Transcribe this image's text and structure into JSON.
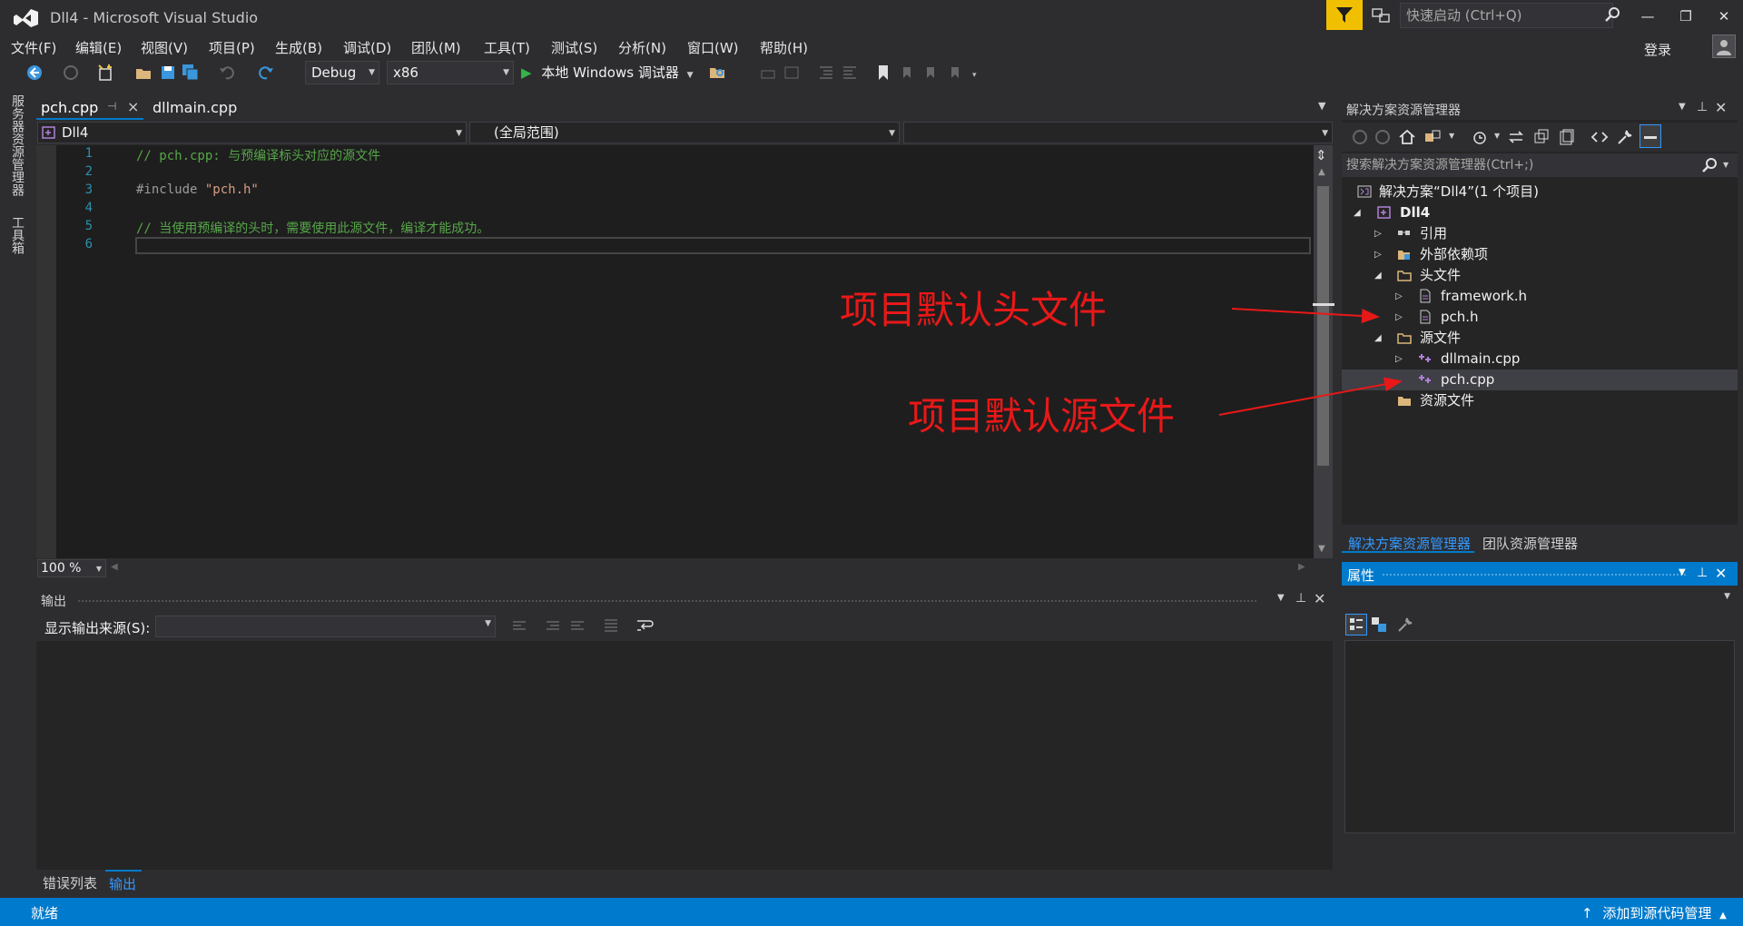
{
  "window": {
    "title": "Dll4 - Microsoft Visual Studio",
    "quick_launch_placeholder": "快速启动 (Ctrl+Q)",
    "minimize": "—",
    "restore": "❐",
    "close": "✕"
  },
  "menu": {
    "items": [
      "文件(F)",
      "编辑(E)",
      "视图(V)",
      "项目(P)",
      "生成(B)",
      "调试(D)",
      "团队(M)",
      "工具(T)",
      "测试(S)",
      "分析(N)",
      "窗口(W)",
      "帮助(H)"
    ],
    "login": "登录"
  },
  "toolbar": {
    "config": "Debug",
    "platform": "x86",
    "run_label": "本地 Windows 调试器"
  },
  "left_strip": {
    "server_explorer": "服务器资源管理器",
    "toolbox": "工具箱"
  },
  "editor": {
    "tabs": [
      {
        "label": "pch.cpp",
        "active": true
      },
      {
        "label": "dllmain.cpp",
        "active": false
      }
    ],
    "nav_project": "Dll4",
    "nav_scope": "(全局范围)",
    "lines": [
      {
        "n": "1",
        "text": "// pch.cpp: 与预编译标头对应的源文件",
        "kind": "comment"
      },
      {
        "n": "2",
        "text": "",
        "kind": "blank"
      },
      {
        "n": "3",
        "pre": "#include ",
        "str": "\"pch.h\"",
        "kind": "include"
      },
      {
        "n": "4",
        "text": "",
        "kind": "blank"
      },
      {
        "n": "5",
        "text": "// 当使用预编译的头时，需要使用此源文件，编译才能成功。",
        "kind": "comment"
      },
      {
        "n": "6",
        "text": "",
        "kind": "blank"
      }
    ],
    "zoom": "100 %"
  },
  "output": {
    "title": "输出",
    "source_label": "显示输出来源(S):",
    "source_value": ""
  },
  "bottom_tabs": {
    "errors": "错误列表",
    "output": "输出"
  },
  "status": {
    "ready": "就绪",
    "source_control": "添加到源代码管理"
  },
  "solution_explorer": {
    "title": "解决方案资源管理器",
    "search_placeholder": "搜索解决方案资源管理器(Ctrl+;)",
    "tree": {
      "solution": "解决方案“Dll4”(1 个项目)",
      "project": "Dll4",
      "references": "引用",
      "external": "外部依赖项",
      "headers": "头文件",
      "framework_h": "framework.h",
      "pch_h": "pch.h",
      "sources": "源文件",
      "dllmain_cpp": "dllmain.cpp",
      "pch_cpp": "pch.cpp",
      "resources": "资源文件"
    },
    "tab_solution": "解决方案资源管理器",
    "tab_team": "团队资源管理器"
  },
  "properties": {
    "title": "属性"
  },
  "annotations": {
    "header_note": "项目默认头文件",
    "source_note": "项目默认源文件"
  },
  "colors": {
    "accent": "#007acc",
    "annotation": "#e81818",
    "feedback": "#f0c000"
  }
}
